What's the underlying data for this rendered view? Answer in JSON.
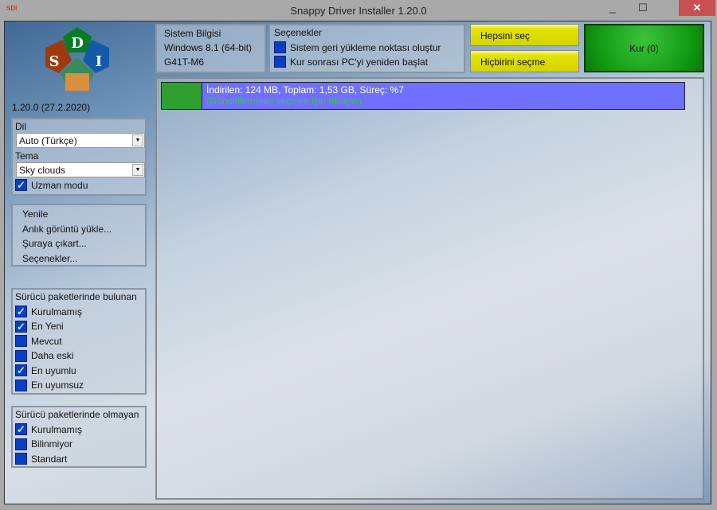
{
  "window": {
    "title": "Snappy Driver Installer 1.20.0",
    "minimize": "_",
    "maximize": "☐",
    "close": "✕"
  },
  "version": "1.20.0 (27.2.2020)",
  "language": {
    "label": "Dil",
    "value": "Auto (Türkçe)"
  },
  "theme": {
    "label": "Tema",
    "value": "Sky clouds"
  },
  "expert_mode": {
    "label": "Uzman modu",
    "checked": true
  },
  "menu": [
    "Yenile",
    "Anlık görüntü yükle...",
    "Şuraya çıkart...",
    "Seçenekler..."
  ],
  "found_group": {
    "title": "Sürücü paketlerinde bulunan",
    "items": [
      {
        "label": "Kurulmamış",
        "checked": "✓"
      },
      {
        "label": "En Yeni",
        "checked": "✓"
      },
      {
        "label": "Mevcut",
        "checked": ""
      },
      {
        "label": "Daha eski",
        "checked": ""
      },
      {
        "label": "En uyumlu",
        "checked": "✓"
      },
      {
        "label": "En uyumsuz",
        "checked": ""
      }
    ]
  },
  "missing_group": {
    "title": "Sürücü paketlerinde olmayan",
    "items": [
      {
        "label": "Kurulmamış",
        "checked": "✓"
      },
      {
        "label": "Bilinmiyor",
        "checked": ""
      },
      {
        "label": "Standart",
        "checked": ""
      }
    ]
  },
  "system_info": {
    "title": "Sistem Bilgisi",
    "os": "Windows 8.1 (64-bit)",
    "board": "G41T-M6"
  },
  "options": {
    "title": "Seçenekler",
    "items": [
      {
        "label": "Sistem geri yükleme noktası oluştur",
        "checked": ""
      },
      {
        "label": "Kur sonrası PC'yi yeniden başlat",
        "checked": ""
      }
    ]
  },
  "buttons": {
    "select_all": "Hepsini seç",
    "select_none": "Hiçbirini seçme",
    "install": "Kur (0)"
  },
  "progress": {
    "percent": 7,
    "text": "İndirilen: 124 MB, Toplam: 1,53 GB, Süreç: %7",
    "hint": "(Güncellemeleri seçmek için tıklayın)"
  },
  "colors": {
    "progress_fill": "#2fa02f",
    "progress_bg": "#7070ff",
    "checkbox": "#0b3fc2",
    "install": "#119911",
    "select": "#e4e400"
  }
}
